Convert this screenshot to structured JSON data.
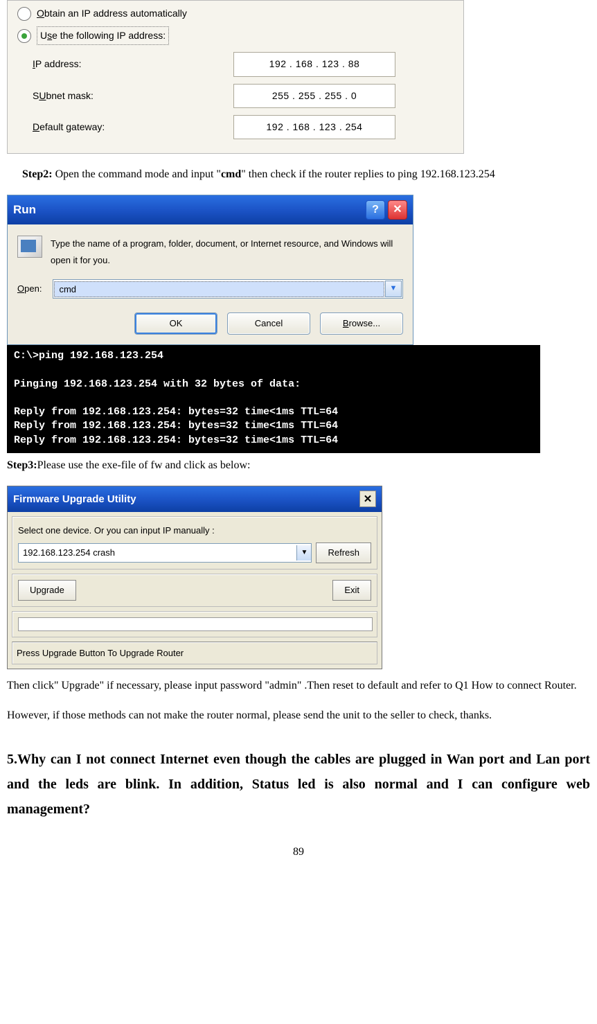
{
  "tcpip": {
    "radio_auto": "Obtain an IP address automatically",
    "radio_manual": "Use the following IP address:",
    "ip_label": "IP address:",
    "ip_label_u": "I",
    "ip_value": "192 . 168 . 123 .  88",
    "subnet_label": "Subnet mask:",
    "subnet_u": "U",
    "subnet_after": "bnet mask:",
    "subnet_value": "255 . 255 . 255 .   0",
    "gateway_label": "Default gateway:",
    "gateway_u": "D",
    "gateway_after": "efault gateway:",
    "gateway_value": "192 . 168 . 123 . 254"
  },
  "step2": {
    "label": "Step2:",
    "text_a": " Open the command mode and input \"",
    "cmd": "cmd",
    "text_b": "\" then check if the router replies to ping 192.168.123.254"
  },
  "run": {
    "title": "Run",
    "msg": "Type the name of a program, folder, document, or Internet resource, and Windows will open it for you.",
    "open_u": "O",
    "open_after": "pen:",
    "value": "cmd",
    "ok": "OK",
    "cancel": "Cancel",
    "browse_u": "B",
    "browse_after": "rowse..."
  },
  "cmd": "C:\\>ping 192.168.123.254\n\nPinging 192.168.123.254 with 32 bytes of data:\n\nReply from 192.168.123.254: bytes=32 time<1ms TTL=64\nReply from 192.168.123.254: bytes=32 time<1ms TTL=64\nReply from 192.168.123.254: bytes=32 time<1ms TTL=64",
  "step3": {
    "label": "Step3:",
    "text": "Please use the exe-file of fw and click as below:"
  },
  "fw": {
    "title": "Firmware Upgrade Utility",
    "select_label": "Select one device. Or you can input IP manually :",
    "device": "192.168.123.254   crash",
    "refresh": "Refresh",
    "upgrade": "Upgrade",
    "exit": "Exit",
    "status": "Press Upgrade Button To Upgrade Router"
  },
  "after_fw": {
    "p1": "Then click\" Upgrade\" if necessary, please input password   \"admin\" .Then reset to default and refer to Q1 How to connect Router.",
    "p2": "However, if those methods can not make the router normal, please send the unit to the seller to check, thanks."
  },
  "question5": "5.Why can I not connect Internet even though the cables are plugged in Wan port and Lan port and the leds are blink. In addition, Status led is also normal and I can configure web management?",
  "page_number": "89"
}
